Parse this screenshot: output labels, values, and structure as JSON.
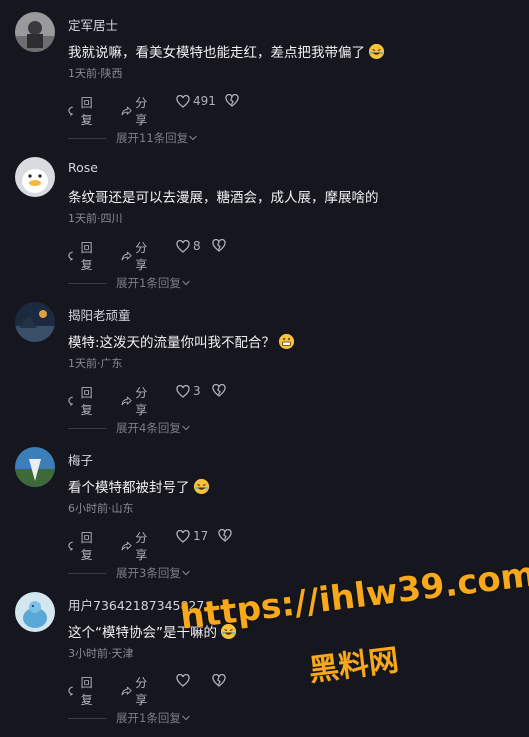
{
  "comments": [
    {
      "username": "定军居士",
      "text": "我就说嘛，看美女模特也能走红，差点把我带偏了",
      "emoji": "rolling-laugh-emoji",
      "meta": "1天前·陕西",
      "reply_label": "回复",
      "share_label": "分享",
      "likes": "491",
      "expand_label": "展开11条回复"
    },
    {
      "username": "Rose",
      "text": "条纹哥还是可以去漫展，糖酒会，成人展，摩展啥的",
      "meta": "1天前·四川",
      "reply_label": "回复",
      "share_label": "分享",
      "likes": "8",
      "expand_label": "展开1条回复"
    },
    {
      "username": "揭阳老顽童",
      "text": "模特:这泼天的流量你叫我不配合？",
      "emoji": "grimace-emoji",
      "meta": "1天前·广东",
      "reply_label": "回复",
      "share_label": "分享",
      "likes": "3",
      "expand_label": "展开4条回复"
    },
    {
      "username": "梅子",
      "text": "看个模特都被封号了",
      "emoji": "rolling-laugh-emoji",
      "meta": "6小时前·山东",
      "reply_label": "回复",
      "share_label": "分享",
      "likes": "17",
      "expand_label": "展开3条回复"
    },
    {
      "username": "用户73642187345827",
      "text": "这个“模特协会”是干嘛的",
      "emoji": "rolling-laugh-emoji",
      "meta": "3小时前·天津",
      "reply_label": "回复",
      "share_label": "分享",
      "likes": "",
      "expand_label": "展开1条回复"
    }
  ],
  "watermark": {
    "url": "https://ihlw39.com",
    "name": "黑料网"
  },
  "colors": {
    "background": "#16161e",
    "watermark": "#f7a81b"
  }
}
